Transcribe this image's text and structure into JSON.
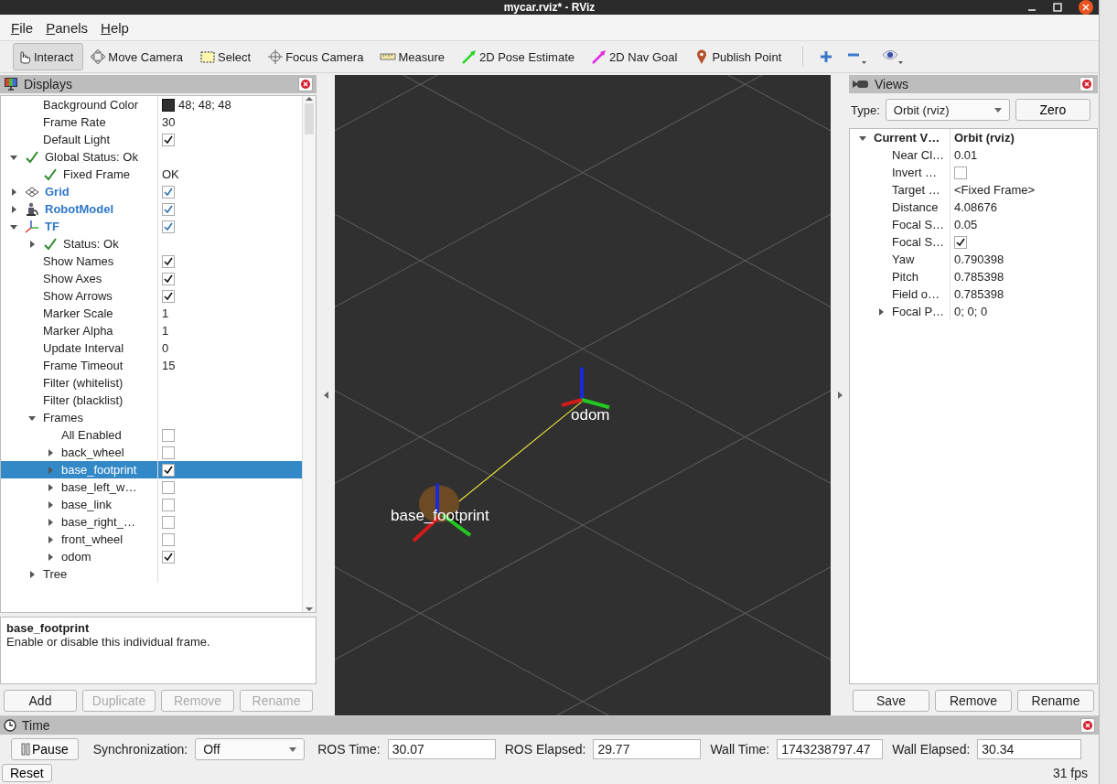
{
  "window": {
    "title": "mycar.rviz* - RViz"
  },
  "menu": [
    "File",
    "Panels",
    "Help"
  ],
  "toolbar": {
    "tools": [
      {
        "label": "Interact",
        "kind": "interact",
        "selected": true
      },
      {
        "label": "Move Camera",
        "kind": "move",
        "selected": false
      },
      {
        "label": "Select",
        "kind": "select",
        "selected": false
      },
      {
        "label": "Focus Camera",
        "kind": "focus",
        "selected": false
      },
      {
        "label": "Measure",
        "kind": "measure",
        "selected": false
      },
      {
        "label": "2D Pose Estimate",
        "kind": "pose",
        "selected": false
      },
      {
        "label": "2D Nav Goal",
        "kind": "goal",
        "selected": false
      },
      {
        "label": "Publish Point",
        "kind": "point",
        "selected": false
      }
    ]
  },
  "displays": {
    "title": "Displays",
    "options": [
      {
        "label": "Background Color",
        "value": "48; 48; 48",
        "color": "#303030"
      },
      {
        "label": "Frame Rate",
        "value": "30"
      },
      {
        "label": "Default Light",
        "checked": true
      }
    ],
    "tree": [
      {
        "label": "Global Status: Ok",
        "kind": "status",
        "expanded": true,
        "selected": false,
        "children": [
          {
            "label": "Fixed Frame",
            "kind": "status",
            "value": "OK",
            "selected": false
          }
        ]
      },
      {
        "label": "Grid",
        "kind": "grid",
        "checked": true,
        "expanded": false,
        "selected": false
      },
      {
        "label": "RobotModel",
        "kind": "robot",
        "checked": true,
        "expanded": false,
        "selected": false
      },
      {
        "label": "TF",
        "kind": "tf",
        "checked": true,
        "expanded": true,
        "selected": false,
        "children": [
          {
            "label": "Status: Ok",
            "kind": "status",
            "expanded": false,
            "selected": false
          },
          {
            "label": "Show Names",
            "checked": true,
            "selected": false
          },
          {
            "label": "Show Axes",
            "checked": true,
            "selected": false
          },
          {
            "label": "Show Arrows",
            "checked": true,
            "selected": false
          },
          {
            "label": "Marker Scale",
            "value": "1",
            "selected": false
          },
          {
            "label": "Marker Alpha",
            "value": "1",
            "selected": false
          },
          {
            "label": "Update Interval",
            "value": "0",
            "selected": false
          },
          {
            "label": "Frame Timeout",
            "value": "15",
            "selected": false
          },
          {
            "label": "Filter (whitelist)",
            "selected": false
          },
          {
            "label": "Filter (blacklist)",
            "selected": false
          },
          {
            "label": "Frames",
            "expanded": true,
            "selected": false,
            "children": [
              {
                "label": "All Enabled",
                "checked": false,
                "selected": false
              },
              {
                "label": "back_wheel",
                "checked": false,
                "expanded": false,
                "selected": false
              },
              {
                "label": "base_footprint",
                "checked": true,
                "expanded": false,
                "selected": true
              },
              {
                "label": "base_left_w…",
                "checked": false,
                "expanded": false,
                "selected": false
              },
              {
                "label": "base_link",
                "checked": false,
                "expanded": false,
                "selected": false
              },
              {
                "label": "base_right_…",
                "checked": false,
                "expanded": false,
                "selected": false
              },
              {
                "label": "front_wheel",
                "checked": false,
                "expanded": false,
                "selected": false
              },
              {
                "label": "odom",
                "checked": true,
                "expanded": false,
                "selected": false
              }
            ]
          },
          {
            "label": "Tree",
            "expanded": false,
            "selected": false
          }
        ]
      }
    ],
    "description": {
      "title": "base_footprint",
      "text": "Enable or disable this individual frame."
    },
    "buttons": [
      {
        "label": "Add",
        "disabled": false
      },
      {
        "label": "Duplicate",
        "disabled": true
      },
      {
        "label": "Remove",
        "disabled": true
      },
      {
        "label": "Rename",
        "disabled": true
      }
    ]
  },
  "scene": {
    "labels": [
      "odom",
      "base_footprint"
    ]
  },
  "views": {
    "title": "Views",
    "type_label": "Type:",
    "type_value": "Orbit (rviz)",
    "zero": "Zero",
    "tree": [
      {
        "label": "Current V…",
        "value": "Orbit (rviz)",
        "kind": "header",
        "expanded": true,
        "children": [
          {
            "label": "Near Cl…",
            "value": "0.01"
          },
          {
            "label": "Invert …",
            "checked": false
          },
          {
            "label": "Target …",
            "value": "<Fixed Frame>"
          },
          {
            "label": "Distance",
            "value": "4.08676"
          },
          {
            "label": "Focal S…",
            "value": "0.05"
          },
          {
            "label": "Focal S…",
            "checked": true
          },
          {
            "label": "Yaw",
            "value": "0.790398"
          },
          {
            "label": "Pitch",
            "value": "0.785398"
          },
          {
            "label": "Field o…",
            "value": "0.785398"
          },
          {
            "label": "Focal P…",
            "value": "0; 0; 0",
            "expanded": false
          }
        ]
      }
    ],
    "buttons": [
      "Save",
      "Remove",
      "Rename"
    ]
  },
  "time": {
    "title": "Time",
    "pause": "Pause",
    "sync_label": "Synchronization:",
    "sync_value": "Off",
    "fields": [
      {
        "label": "ROS Time:",
        "value": "30.07"
      },
      {
        "label": "ROS Elapsed:",
        "value": "29.77"
      },
      {
        "label": "Wall Time:",
        "value": "1743238797.47"
      },
      {
        "label": "Wall Elapsed:",
        "value": "30.34"
      }
    ],
    "reset": "Reset",
    "fps": "31 fps"
  }
}
